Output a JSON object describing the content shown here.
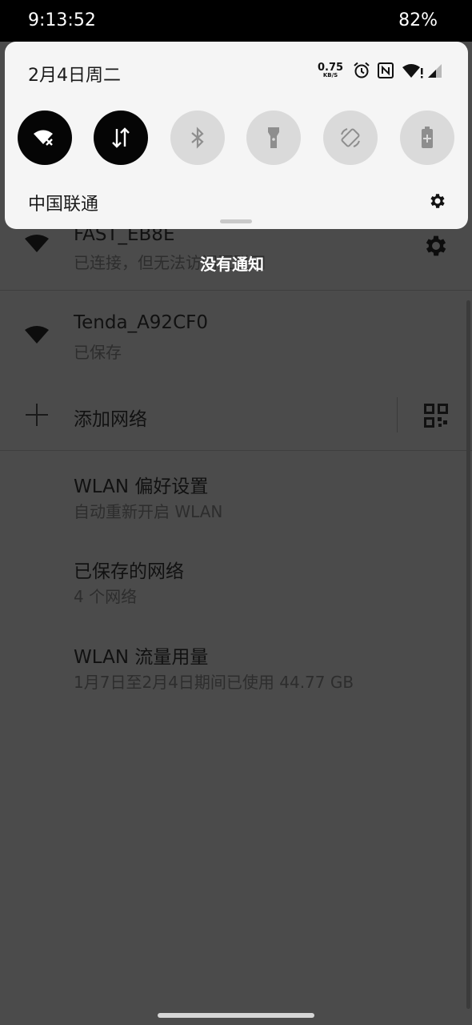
{
  "status_bar": {
    "time": "9:13:52",
    "battery": "82%"
  },
  "quick_settings": {
    "date": "2月4日周二",
    "net_speed_value": "0.75",
    "net_speed_unit": "KB/S",
    "carrier": "中国联通",
    "tiles": [
      {
        "name": "wlan",
        "icon": "wifi-off-icon",
        "state": "on"
      },
      {
        "name": "mobile-data",
        "icon": "data-transfer-icon",
        "state": "on"
      },
      {
        "name": "bluetooth",
        "icon": "bluetooth-icon",
        "state": "off"
      },
      {
        "name": "flashlight",
        "icon": "flashlight-icon",
        "state": "off"
      },
      {
        "name": "auto-rotate",
        "icon": "auto-rotate-icon",
        "state": "off"
      },
      {
        "name": "battery-saver",
        "icon": "battery-saver-icon",
        "state": "off"
      }
    ]
  },
  "notifications": {
    "empty_text": "没有通知"
  },
  "wifi_list": {
    "networks": [
      {
        "ssid": "FAST_EB8E",
        "status": "已连接，但无法访问互联网"
      },
      {
        "ssid": "Tenda_A92CF0",
        "status": "已保存"
      }
    ],
    "add_network": "添加网络"
  },
  "settings": [
    {
      "title": "WLAN 偏好设置",
      "subtitle": "自动重新开启 WLAN"
    },
    {
      "title": "已保存的网络",
      "subtitle": "4 个网络"
    },
    {
      "title": "WLAN 流量用量",
      "subtitle": "1月7日至2月4日期间已使用 44.77 GB"
    }
  ]
}
